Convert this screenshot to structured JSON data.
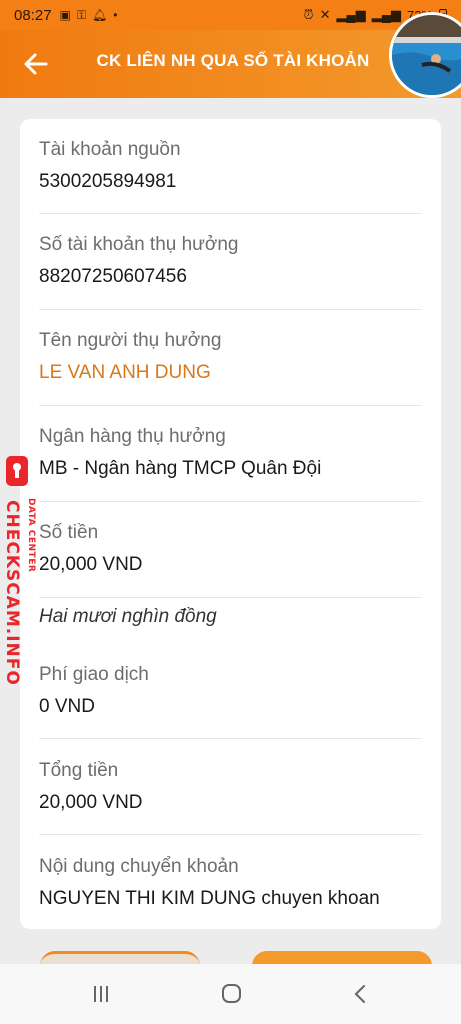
{
  "status_bar": {
    "time": "08:27",
    "battery": "73%"
  },
  "app_bar": {
    "title": "CK LIÊN NH QUA SỐ TÀI KHOẢN"
  },
  "details": {
    "source_account": {
      "label": "Tài khoản nguồn",
      "value": "5300205894981"
    },
    "beneficiary_account": {
      "label": "Số tài khoản thụ hưởng",
      "value": "88207250607456"
    },
    "beneficiary_name": {
      "label": "Tên người thụ hưởng",
      "value": "LE VAN ANH DUNG"
    },
    "beneficiary_bank": {
      "label": "Ngân hàng thụ hưởng",
      "value": "MB - Ngân hàng TMCP Quân Đội"
    },
    "amount": {
      "label": "Số tiền",
      "value": "20,000 VND",
      "in_words": "Hai mươi nghìn đồng"
    },
    "fee": {
      "label": "Phí giao dịch",
      "value": "0 VND"
    },
    "total": {
      "label": "Tổng tiền",
      "value": "20,000 VND"
    },
    "content": {
      "label": "Nội dung chuyển khoản",
      "value": "NGUYEN THI KIM DUNG chuyen khoan"
    }
  },
  "watermark": {
    "main": "CHECKSCAM.INFO",
    "sub": "DATA CENTER"
  },
  "colors": {
    "accent": "#f47f14",
    "name_highlight": "#d9771a",
    "watermark": "#e8262c"
  }
}
